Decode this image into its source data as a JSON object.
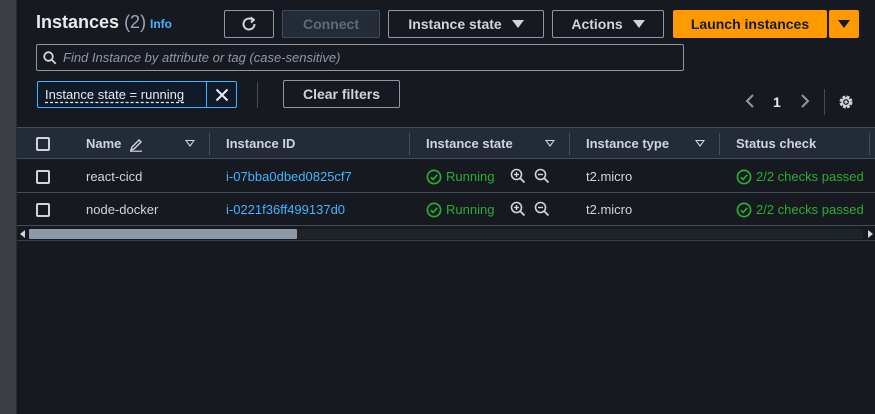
{
  "header": {
    "title": "Instances",
    "count": "(2)",
    "info_label": "Info",
    "refresh_icon": "refresh-icon",
    "connect_label": "Connect",
    "instance_state_label": "Instance state",
    "actions_label": "Actions",
    "launch_label": "Launch instances"
  },
  "search": {
    "placeholder": "Find Instance by attribute or tag (case-sensitive)",
    "value": ""
  },
  "filters": {
    "token_label": "Instance state = running",
    "clear_label": "Clear filters"
  },
  "pagination": {
    "current_page": "1"
  },
  "table": {
    "columns": [
      "Name",
      "Instance ID",
      "Instance state",
      "Instance type",
      "Status check"
    ],
    "rows": [
      {
        "name": "react-cicd",
        "instance_id": "i-07bba0dbed0825cf7",
        "state": "Running",
        "type": "t2.micro",
        "status": "2/2 checks passed"
      },
      {
        "name": "node-docker",
        "instance_id": "i-0221f36ff499137d0",
        "state": "Running",
        "type": "t2.micro",
        "status": "2/2 checks passed"
      }
    ]
  },
  "colors": {
    "accent": "#ff9900",
    "link": "#42b4ff",
    "success": "#29ad32",
    "background": "#16191f"
  }
}
